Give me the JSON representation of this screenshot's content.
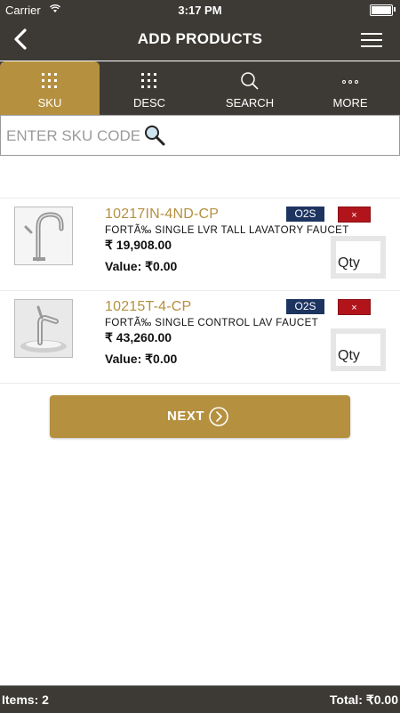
{
  "status_bar": {
    "carrier": "Carrier",
    "time": "3:17 PM"
  },
  "header": {
    "title": "ADD PRODUCTS",
    "background": "#3d3a35",
    "accent": "#b5903f"
  },
  "tabs": [
    {
      "label": "SKU",
      "icon": "grid-icon",
      "active": true
    },
    {
      "label": "DESC",
      "icon": "grid-icon",
      "active": false
    },
    {
      "label": "SEARCH",
      "icon": "search-icon",
      "active": false
    },
    {
      "label": "MORE",
      "icon": "more-icon",
      "active": false
    }
  ],
  "sku_search": {
    "placeholder": "ENTER SKU CODE",
    "value": ""
  },
  "products": [
    {
      "sku": "10217IN-4ND-CP",
      "description": "FORTÃ‰ SINGLE LVR TALL LAVATORY FAUCET",
      "price": "₹ 19,908.00",
      "value": "Value: ₹0.00",
      "badge": "O2S",
      "remove": "×",
      "qty_placeholder": "Qty"
    },
    {
      "sku": "10215T-4-CP",
      "description": "FORTÃ‰ SINGLE CONTROL LAV FAUCET",
      "price": "₹ 43,260.00",
      "value": "Value: ₹0.00",
      "badge": "O2S",
      "remove": "×",
      "qty_placeholder": "Qty"
    }
  ],
  "next_button": {
    "label": "NEXT"
  },
  "footer": {
    "items": "Items: 2",
    "total": "Total: ₹0.00"
  },
  "colors": {
    "badge": "#1d3461",
    "remove": "#b1151b"
  }
}
